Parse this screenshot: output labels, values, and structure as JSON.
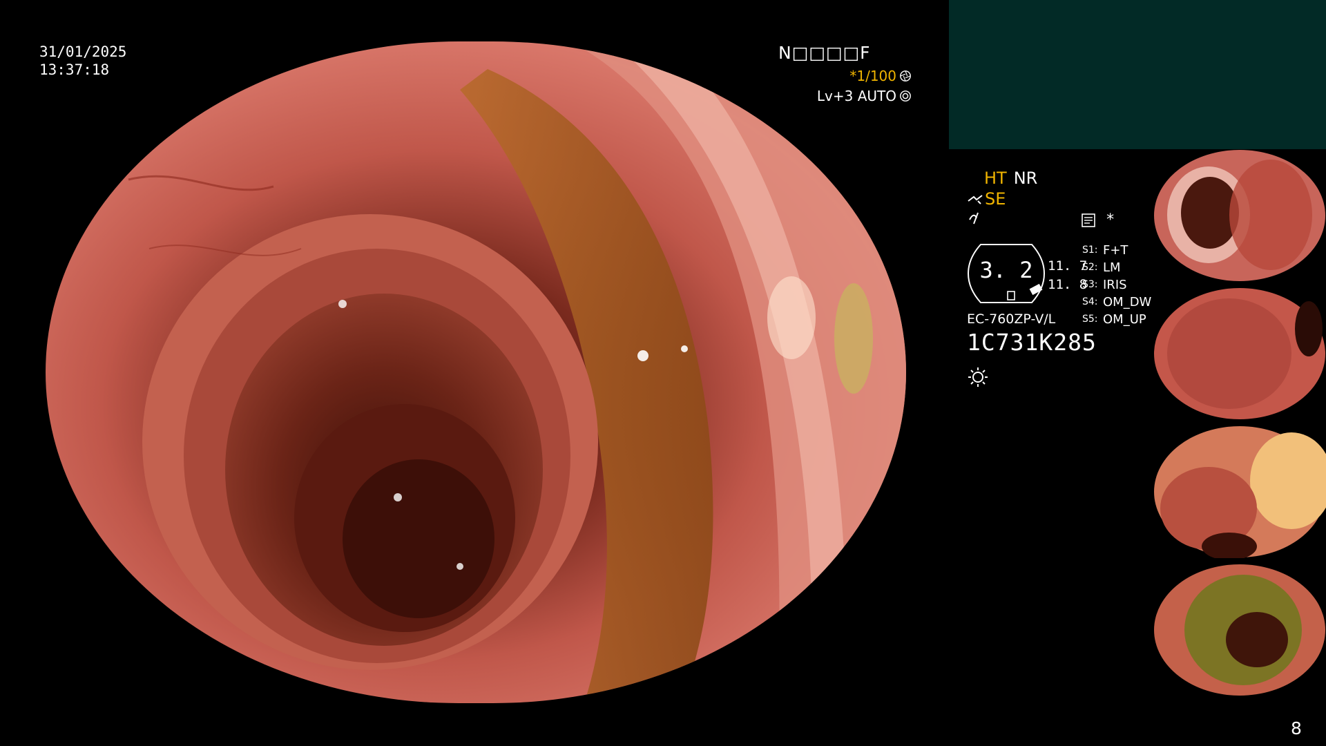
{
  "header": {
    "date": "31/01/2025",
    "time": "13:37:18",
    "patient_id": "N□□□□F",
    "shutter": "*1/100",
    "level": "Lv+3 AUTO"
  },
  "panel": {
    "ht": "HT",
    "nr": "NR",
    "se": "SE",
    "structure_enhancement": "3. 2",
    "enh_value_1": "11. 7",
    "enh_value_2": "11. 8",
    "scope_model": "EC-760ZP-V/L",
    "scope_serial": "1C731K285",
    "memo_star": "*",
    "switches": [
      {
        "key": "S1:",
        "value": "F+T"
      },
      {
        "key": "S2:",
        "value": "LM"
      },
      {
        "key": "S3:",
        "value": "IRIS"
      },
      {
        "key": "S4:",
        "value": "OM_DW"
      },
      {
        "key": "S5:",
        "value": "OM_UP"
      }
    ]
  },
  "page_number": "8",
  "colors": {
    "accent": "#f0b400",
    "panel_teal": "#022a26",
    "mucosa": "#c9564a"
  },
  "icons": {
    "shutter": "aperture-icon",
    "level": "target-icon",
    "se": "scope-tip-icon",
    "glyph": "wave-icon",
    "memo": "memo-icon",
    "light": "sun-icon"
  }
}
